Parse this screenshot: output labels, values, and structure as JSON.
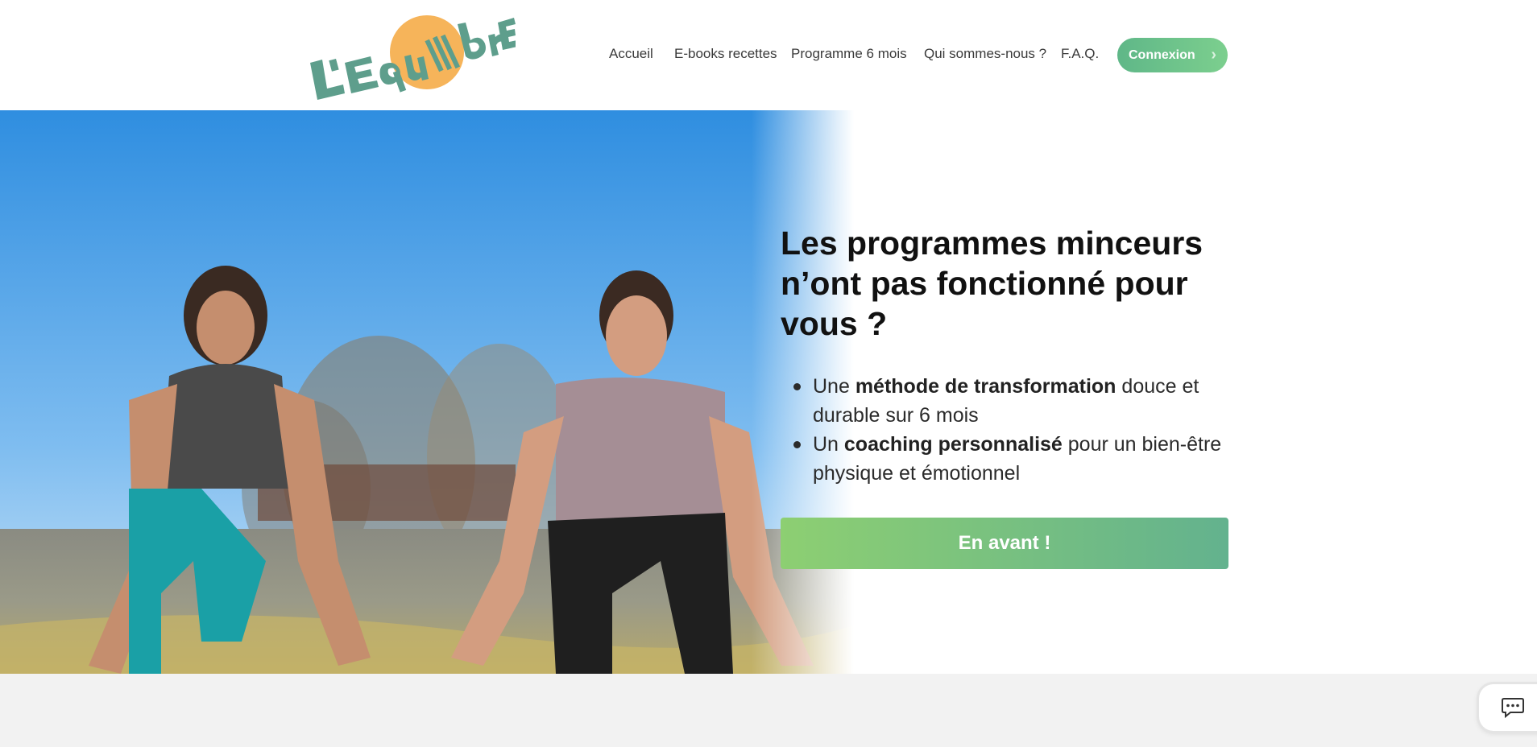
{
  "header": {
    "logo_text": "L'Equilibre",
    "nav": [
      {
        "label": "Accueil"
      },
      {
        "label": "E-books recettes"
      },
      {
        "label": "Programme 6 mois"
      },
      {
        "label": "Qui sommes-nous ?"
      },
      {
        "label": "F.A.Q."
      }
    ],
    "connexion_label": "Connexion"
  },
  "hero": {
    "headline": "Les programmes minceurs n’ont pas fonctionné pour vous ?",
    "bullets": [
      {
        "pre": "Une ",
        "bold": "méthode de transformation",
        "post": " douce et durable sur 6 mois"
      },
      {
        "pre": "Un ",
        "bold": "coaching personnalisé",
        "post": " pour un bien-être physique et émotionnel"
      }
    ],
    "cta_label": "En avant !"
  },
  "colors": {
    "brand_green": "#63b28e",
    "cta_light_green": "#8dcf72",
    "logo_teal": "#5e9e8c",
    "logo_orange": "#f6b45a",
    "footer_band": "#f2f2f2"
  },
  "icons": {
    "connexion_chevron": "chevron-right-icon",
    "chat": "chat-bubble-icon"
  }
}
